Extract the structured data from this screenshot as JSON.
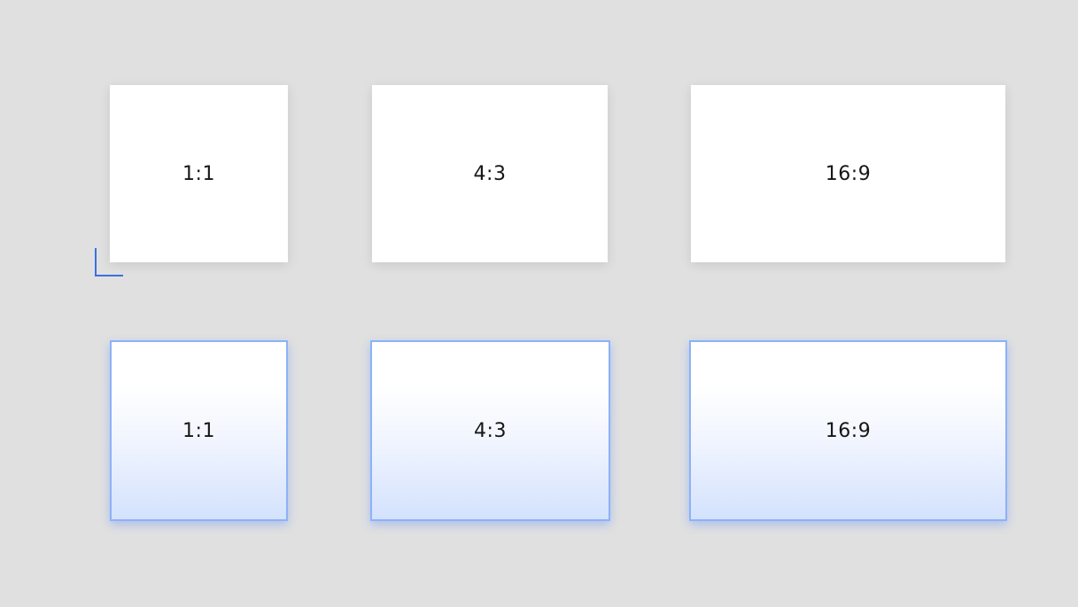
{
  "tiles_default": [
    {
      "label": "1:1"
    },
    {
      "label": "4:3"
    },
    {
      "label": "16:9"
    }
  ],
  "tiles_hover": [
    {
      "label": "1:1"
    },
    {
      "label": "4:3"
    },
    {
      "label": "16:9"
    }
  ],
  "colors": {
    "background": "#e0e0e0",
    "tile": "#ffffff",
    "hover_border": "#8cb2f8",
    "hover_gradient_bottom": "#d4e2fd",
    "focus_corner": "#3b6fe0",
    "text": "#161616"
  }
}
